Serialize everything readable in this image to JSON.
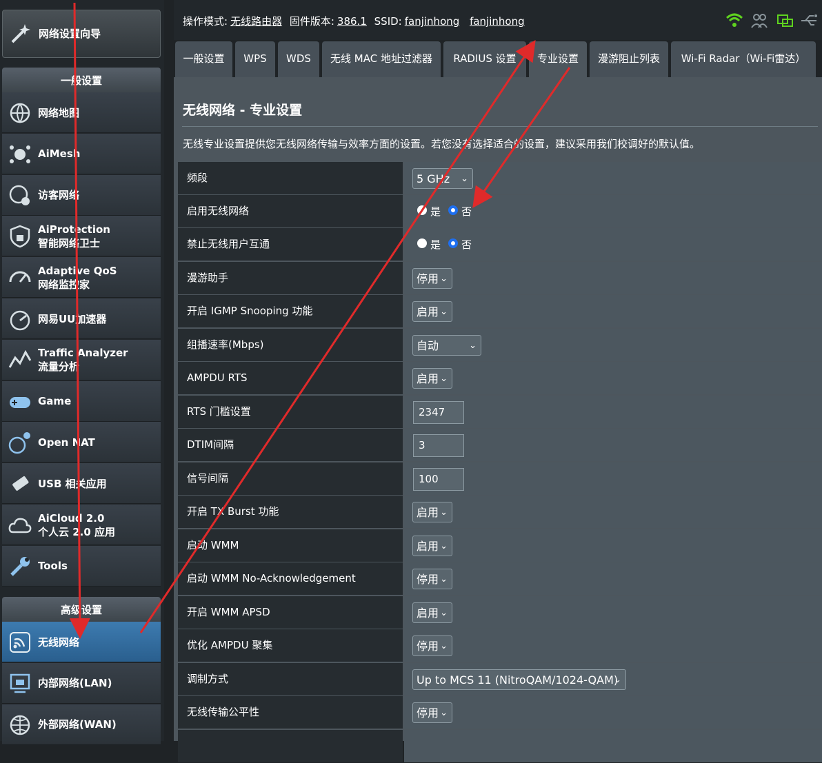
{
  "sidebar": {
    "wizard_label": "网络设置向导",
    "general_header": "一般设置",
    "general_items": [
      {
        "line1": "网络地图",
        "line2": "",
        "icon": "globe-icon"
      },
      {
        "line1": "AiMesh",
        "line2": "",
        "icon": "mesh-icon"
      },
      {
        "line1": "访客网络",
        "line2": "",
        "icon": "guest-network-icon"
      },
      {
        "line1": "AiProtection",
        "line2": "智能网络卫士",
        "icon": "shield-icon"
      },
      {
        "line1": "Adaptive QoS",
        "line2": "网络监控家",
        "icon": "gauge-icon"
      },
      {
        "line1": "网易UU加速器",
        "line2": "",
        "icon": "speedometer-icon"
      },
      {
        "line1": "Traffic Analyzer",
        "line2": "流量分析",
        "icon": "analyzer-icon"
      },
      {
        "line1": "Game",
        "line2": "",
        "icon": "gamepad-icon"
      },
      {
        "line1": "Open NAT",
        "line2": "",
        "icon": "open-nat-icon"
      },
      {
        "line1": "USB 相关应用",
        "line2": "",
        "icon": "usb-icon"
      },
      {
        "line1": "AiCloud 2.0",
        "line2": "个人云 2.0 应用",
        "icon": "cloud-icon"
      },
      {
        "line1": "Tools",
        "line2": "",
        "icon": "wrench-icon"
      }
    ],
    "advanced_header": "高级设置",
    "advanced_items": [
      {
        "line1": "无线网络",
        "icon": "wifi-icon"
      },
      {
        "line1": "内部网络(LAN)",
        "icon": "lan-icon"
      },
      {
        "line1": "外部网络(WAN)",
        "icon": "wan-globe-icon"
      }
    ]
  },
  "topbar": {
    "mode_label": "操作模式:",
    "mode_value": "无线路由器",
    "firmware_label": "固件版本:",
    "firmware_value": "386.1",
    "ssid_label": "SSID:",
    "ssid_1": "fanjinhong",
    "ssid_2": "fanjinhong"
  },
  "tabs": [
    "一般设置",
    "WPS",
    "WDS",
    "无线 MAC 地址过滤器",
    "RADIUS 设置",
    "专业设置",
    "漫游阻止列表",
    "Wi-Fi Radar（Wi-Fi雷达）"
  ],
  "page": {
    "title": "无线网络 - 专业设置",
    "description": "无线专业设置提供您无线网络传输与效率方面的设置。若您没有选择适合的设置，建议采用我们校调好的默认值。"
  },
  "settings": [
    {
      "label": "频段",
      "value": "5 GHz"
    },
    {
      "label": "启用无线网络",
      "yes": "是",
      "no": "否",
      "selected": "否"
    },
    {
      "label": "禁止无线用户互通",
      "yes": "是",
      "no": "否",
      "selected": "否"
    },
    {
      "label": "漫游助手",
      "value": "停用"
    },
    {
      "label": "开启 IGMP Snooping 功能",
      "value": "启用"
    },
    {
      "label": "组播速率(Mbps)",
      "value": "自动"
    },
    {
      "label": "AMPDU RTS",
      "value": "启用"
    },
    {
      "label": "RTS 门槛设置",
      "value": "2347"
    },
    {
      "label": "DTIM间隔",
      "value": "3"
    },
    {
      "label": "信号间隔",
      "value": "100"
    },
    {
      "label": "开启 TX Burst 功能",
      "value": "启用"
    },
    {
      "label": "启动 WMM",
      "value": "启用"
    },
    {
      "label": "启动 WMM No-Acknowledgement",
      "value": "停用"
    },
    {
      "label": "开启 WMM APSD",
      "value": "启用"
    },
    {
      "label": "优化 AMPDU 聚集",
      "value": "停用"
    },
    {
      "label": "调制方式",
      "value": "Up to MCS 11 (NitroQAM/1024-QAM)"
    },
    {
      "label": "无线传输公平性",
      "value": "停用"
    }
  ],
  "colors": {
    "accent_blue": "#1e6ff0",
    "annotation_red": "#e02a2a",
    "active_menu": "#3d7bb0"
  }
}
